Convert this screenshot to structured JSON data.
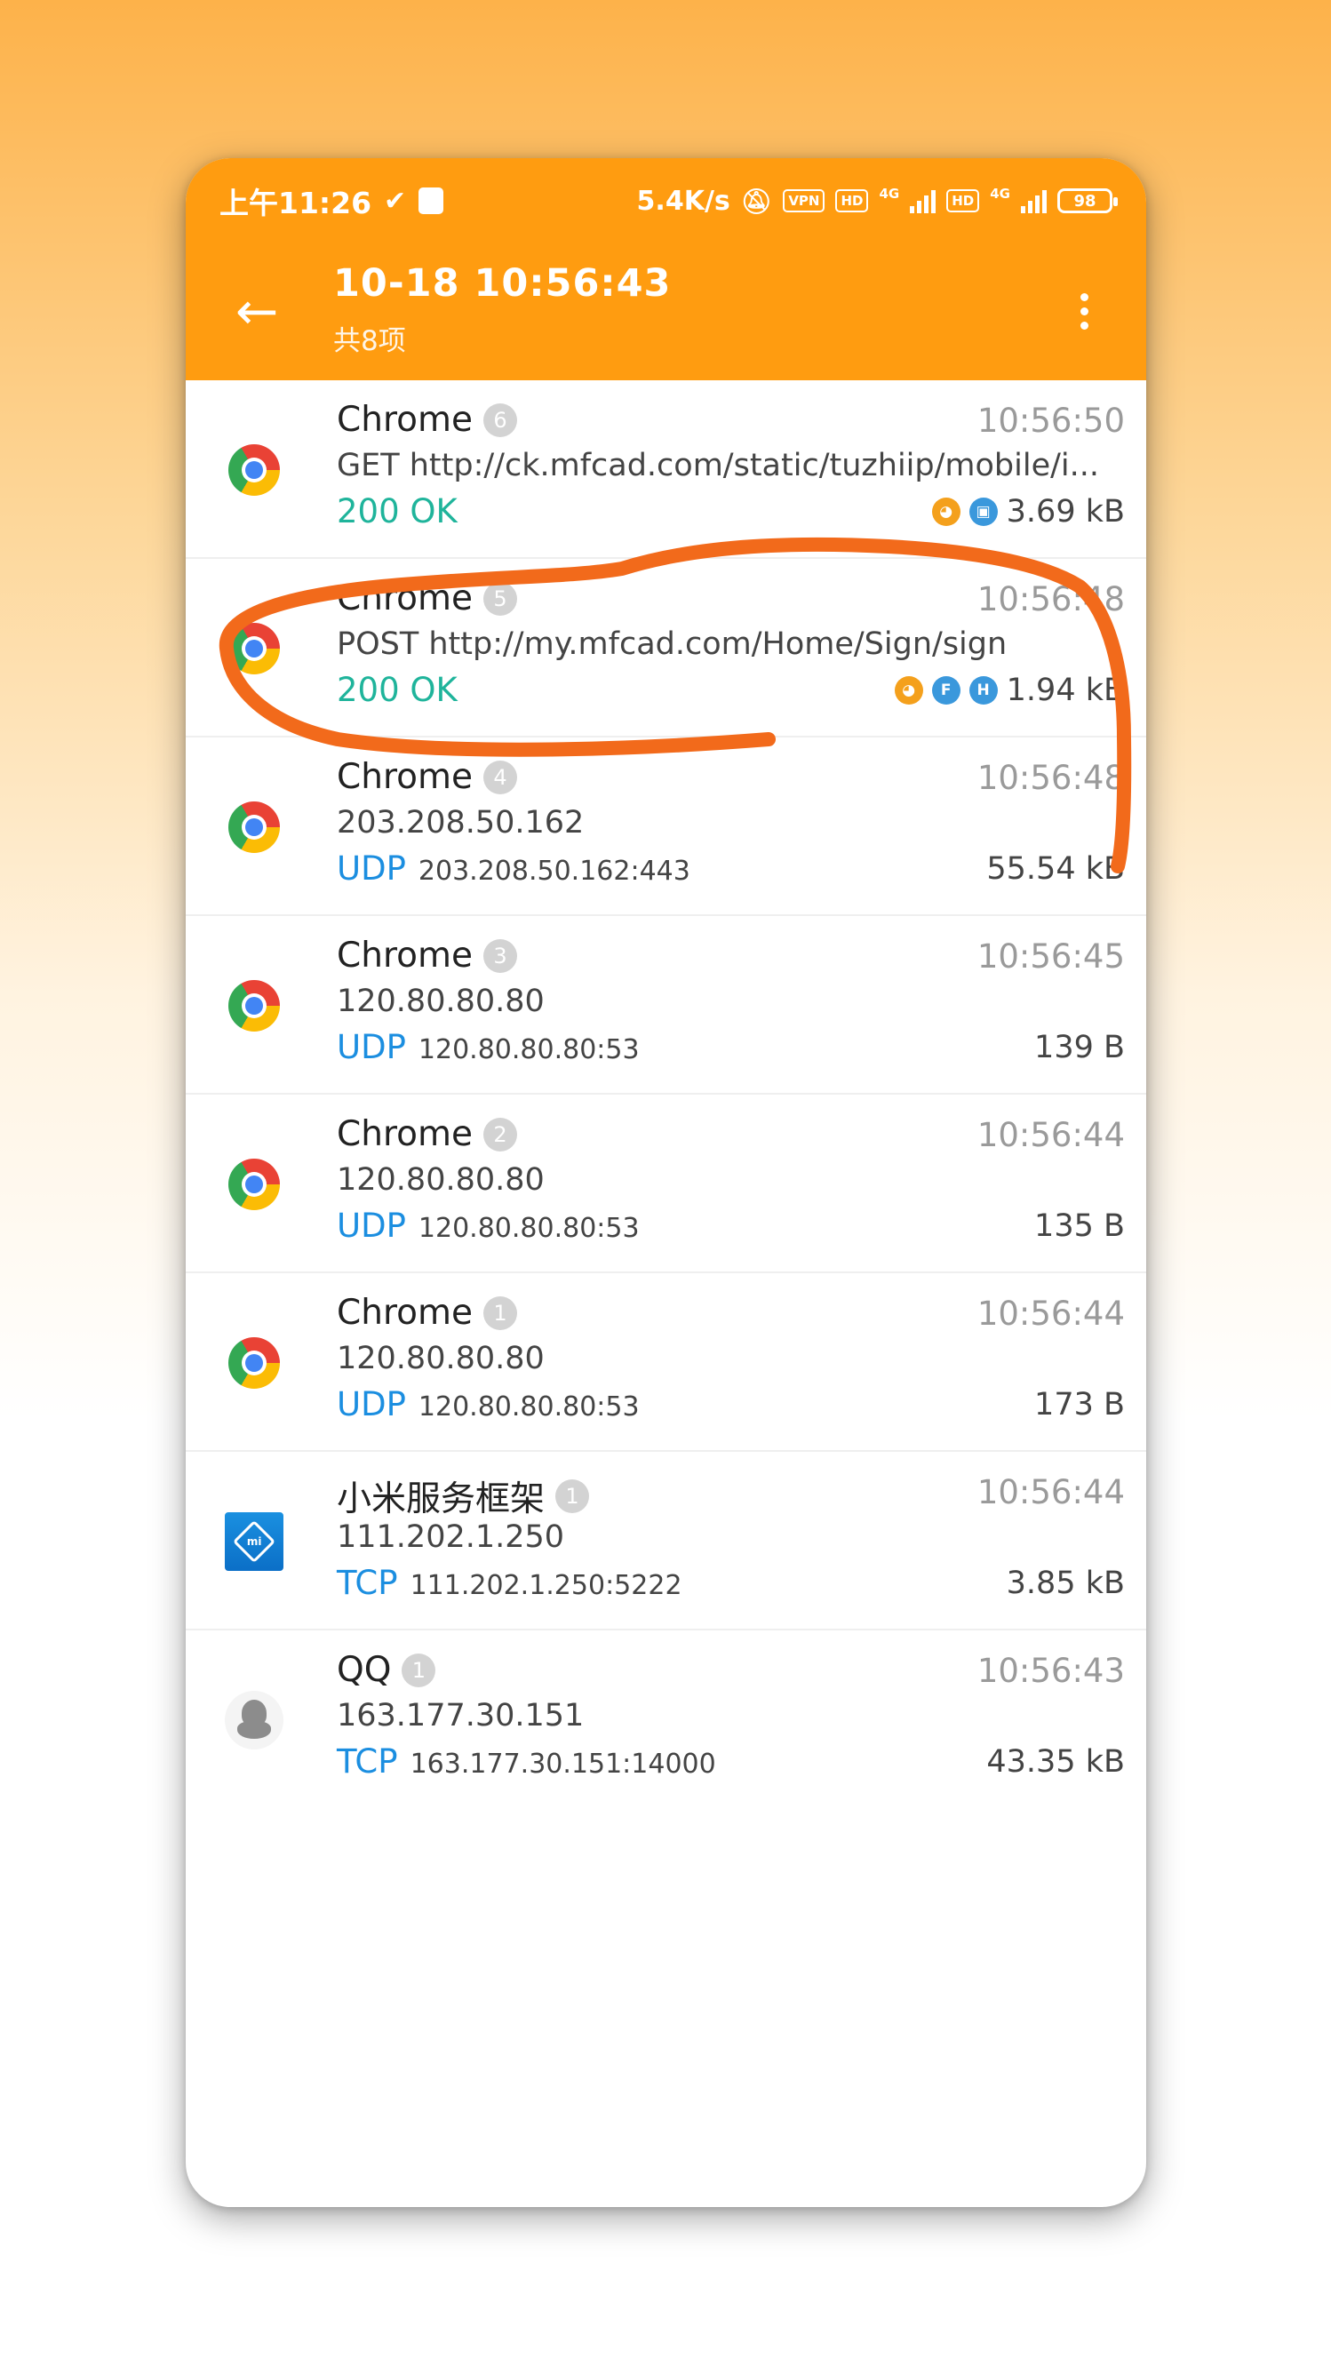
{
  "status_bar": {
    "time": "上午11:26",
    "net_speed": "5.4K/s",
    "vpn": "VPN",
    "hd1": "HD",
    "net1": "4G",
    "hd2": "HD",
    "net2": "4G",
    "battery": "98"
  },
  "toolbar": {
    "title": "10-18 10:56:43",
    "subtitle": "共8项"
  },
  "rows": [
    {
      "app": "Chrome",
      "count": "6",
      "time": "10:56:50",
      "detail": "GET http://ck.mfcad.com/static/tuzhiip/mobile/i...",
      "status": "200 OK",
      "size": "3.69 kB"
    },
    {
      "app": "Chrome",
      "count": "5",
      "time": "10:56:48",
      "detail": "POST http://my.mfcad.com/Home/Sign/sign",
      "status": "200 OK",
      "size": "1.94 kB",
      "badges": [
        "F",
        "H"
      ]
    },
    {
      "app": "Chrome",
      "count": "4",
      "time": "10:56:48",
      "detail": "203.208.50.162",
      "protocol": "UDP",
      "address": "203.208.50.162:443",
      "size": "55.54 kB"
    },
    {
      "app": "Chrome",
      "count": "3",
      "time": "10:56:45",
      "detail": "120.80.80.80",
      "protocol": "UDP",
      "address": "120.80.80.80:53",
      "size": "139 B"
    },
    {
      "app": "Chrome",
      "count": "2",
      "time": "10:56:44",
      "detail": "120.80.80.80",
      "protocol": "UDP",
      "address": "120.80.80.80:53",
      "size": "135 B"
    },
    {
      "app": "Chrome",
      "count": "1",
      "time": "10:56:44",
      "detail": "120.80.80.80",
      "protocol": "UDP",
      "address": "120.80.80.80:53",
      "size": "173 B"
    },
    {
      "app": "小米服务框架",
      "count": "1",
      "time": "10:56:44",
      "detail": "111.202.1.250",
      "protocol": "TCP",
      "address": "111.202.1.250:5222",
      "size": "3.85 kB",
      "icon_text": "mi"
    },
    {
      "app": "QQ",
      "count": "1",
      "time": "10:56:43",
      "detail": "163.177.30.151",
      "protocol": "TCP",
      "address": "163.177.30.151:14000",
      "size": "43.35 kB"
    }
  ],
  "colors": {
    "accent": "#ff9c10",
    "ok": "#1fb49b",
    "protocol": "#1b8ee0",
    "annotation": "#f26a1b"
  }
}
